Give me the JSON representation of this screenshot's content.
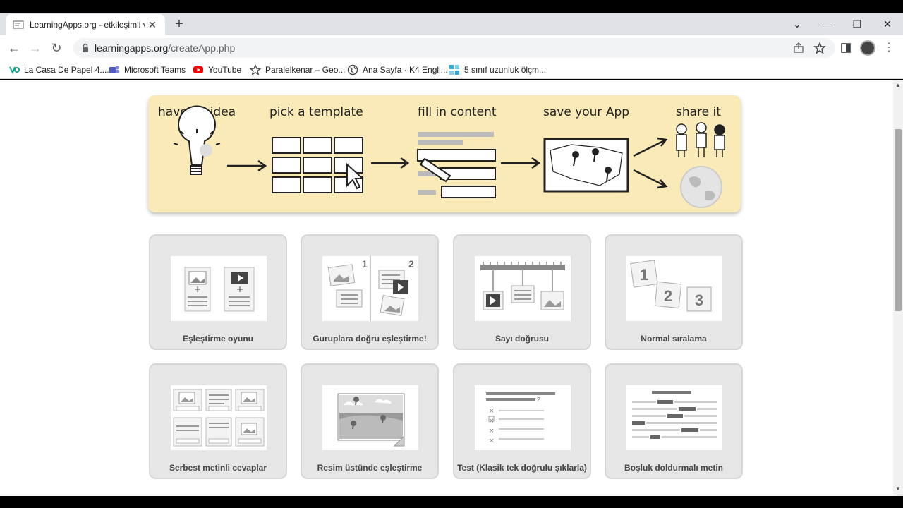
{
  "browser": {
    "tab_title": "LearningApps.org - etkileşimli ve",
    "url_host": "learningapps.org",
    "url_path": "/createApp.php",
    "bookmarks": [
      {
        "label": "La Casa De Papel 4...."
      },
      {
        "label": "Microsoft Teams"
      },
      {
        "label": "YouTube"
      },
      {
        "label": "Paralelkenar – Geo..."
      },
      {
        "label": "Ana Sayfa · K4 Engli..."
      },
      {
        "label": "5 sınıf uzunluk ölçm..."
      }
    ]
  },
  "banner": {
    "steps": [
      {
        "label": "have an idea"
      },
      {
        "label": "pick a template"
      },
      {
        "label": "fill in content"
      },
      {
        "label": "save your App"
      },
      {
        "label": "share it"
      }
    ],
    "background_color": "#faeab7"
  },
  "templates": [
    {
      "label": "Eşleştirme oyunu",
      "icon": "pair-matching-thumbnail"
    },
    {
      "label": "Guruplara doğru eşleştirme!",
      "icon": "group-assignment-thumbnail"
    },
    {
      "label": "Sayı doğrusu",
      "icon": "number-line-thumbnail"
    },
    {
      "label": "Normal sıralama",
      "icon": "simple-order-thumbnail"
    },
    {
      "label": "Serbest metinli cevaplar",
      "icon": "free-text-input-thumbnail"
    },
    {
      "label": "Resim üstünde eşleştirme",
      "icon": "matching-on-image-thumbnail"
    },
    {
      "label": "Test (Klasik tek doğrulu şıklarla)",
      "icon": "multiple-choice-thumbnail"
    },
    {
      "label": "Boşluk doldurmalı metin",
      "icon": "cloze-text-thumbnail"
    }
  ],
  "thumb_text": {
    "group_1": "1",
    "group_2": "2",
    "order_1": "1",
    "order_2": "2",
    "order_3": "3",
    "question_mark": "?"
  },
  "colors": {
    "card_bg": "#e6e6e6",
    "tab_strip": "#dee1e6"
  }
}
